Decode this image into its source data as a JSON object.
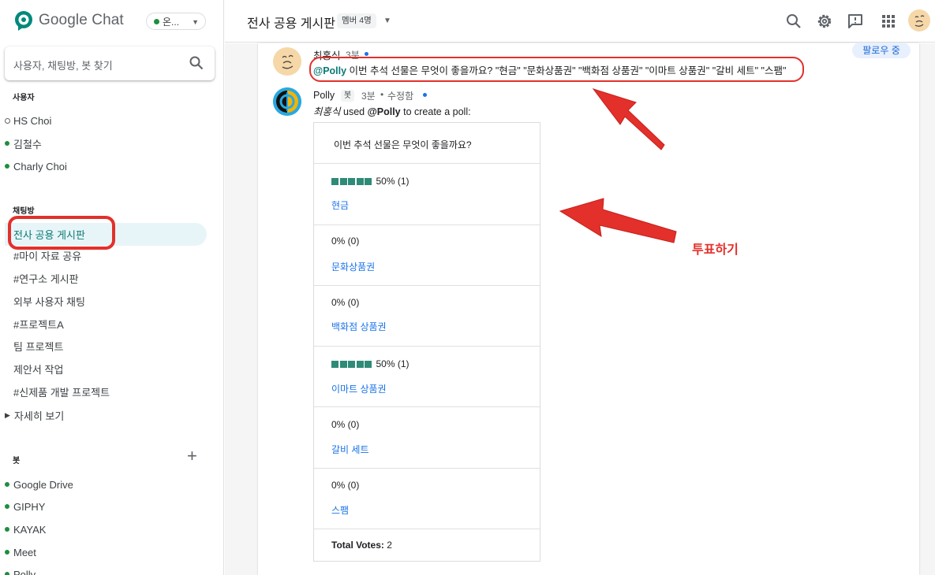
{
  "app": {
    "name": "Google Chat",
    "status_label": "온..."
  },
  "search": {
    "placeholder": "사용자, 채팅방, 봇 찾기"
  },
  "sections": {
    "users": "사용자",
    "rooms": "채팅방",
    "bots": "봇"
  },
  "users": [
    {
      "name": "HS Choi",
      "online": false
    },
    {
      "name": "김철수",
      "online": true
    },
    {
      "name": "Charly Choi",
      "online": true
    }
  ],
  "rooms": [
    "전사 공용 게시판",
    "#마이 자료 공유",
    "#연구소 게시판",
    "외부 사용자 채팅",
    "#프로젝트A",
    "팀 프로젝트",
    "제안서 작업",
    "#신제품 개발 프로젝트"
  ],
  "more_label": "자세히 보기",
  "bots": [
    "Google Drive",
    "GIPHY",
    "KAYAK",
    "Meet",
    "Polly"
  ],
  "header": {
    "room_title": "전사 공용 게시판",
    "member_count": "멤버 4명"
  },
  "thread": {
    "follow_label": "팔로우 중",
    "message1": {
      "author": "최홍식",
      "time": "3분",
      "mention": "@Polly",
      "text": " 이번 추석 선물은 무엇이 좋을까요? \"현금\" \"문화상품권\" \"백화점 상품권\" \"이마트 상품권\" \"갈비 세트\" \"스팸\""
    },
    "message2": {
      "author": "Polly",
      "badge": "봇",
      "time": "3분",
      "edited": "수정함",
      "intro_user": "최홍식",
      "intro_used": " used ",
      "intro_mention": "@Polly",
      "intro_rest": " to create a poll:"
    }
  },
  "poll": {
    "question": "이번 추석 선물은 무엇이 좋을까요?",
    "options": [
      {
        "label": "현금",
        "stat": "50% (1)",
        "percent": 50
      },
      {
        "label": "문화상품권",
        "stat": "0% (0)",
        "percent": 0
      },
      {
        "label": "백화점 상품권",
        "stat": "0% (0)",
        "percent": 0
      },
      {
        "label": "이마트 상품권",
        "stat": "50% (1)",
        "percent": 50
      },
      {
        "label": "갈비 세트",
        "stat": "0% (0)",
        "percent": 0
      },
      {
        "label": "스팸",
        "stat": "0% (0)",
        "percent": 0
      }
    ],
    "total_label": "Total Votes:",
    "total_value": " 2"
  },
  "annotation": {
    "label": "투표하기",
    "color": "#e3302b"
  },
  "colors": {
    "accent": "#0b7a75",
    "link": "#1a73e8",
    "online": "#1e8e3e",
    "bar": "#2e8b77"
  }
}
